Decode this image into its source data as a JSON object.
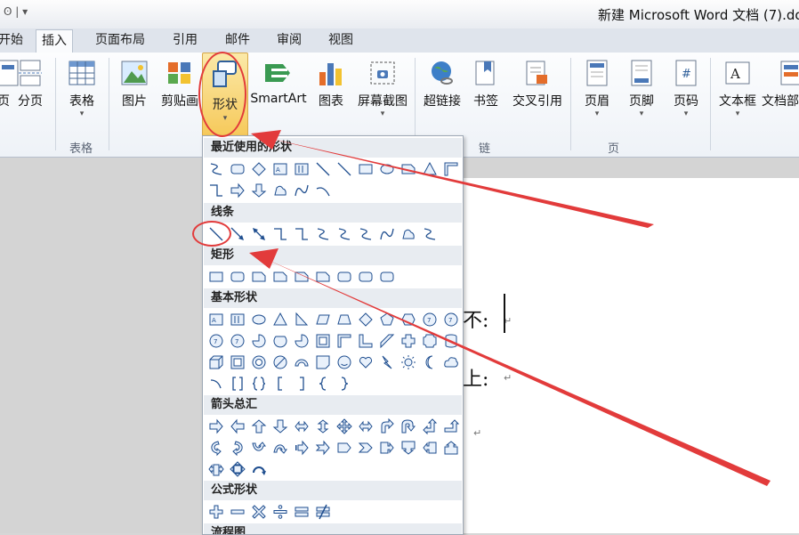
{
  "window": {
    "title": "新建 Microsoft Word 文档 (7).do",
    "qa_mark": "ʘ | ▾"
  },
  "tabs": [
    {
      "label": "开始"
    },
    {
      "label": "插入"
    },
    {
      "label": "页面布局"
    },
    {
      "label": "引用"
    },
    {
      "label": "邮件"
    },
    {
      "label": "审阅"
    },
    {
      "label": "视图"
    }
  ],
  "ribbon": {
    "buttons": [
      {
        "label": "页"
      },
      {
        "label": "分页"
      },
      {
        "label": "表格"
      },
      {
        "label": "图片"
      },
      {
        "label": "剪贴画"
      },
      {
        "label": "形状"
      },
      {
        "label": "SmartArt"
      },
      {
        "label": "图表"
      },
      {
        "label": "屏幕截图"
      },
      {
        "label": "超链接"
      },
      {
        "label": "书签"
      },
      {
        "label": "交叉引用"
      },
      {
        "label": "页眉"
      },
      {
        "label": "页脚"
      },
      {
        "label": "页码"
      },
      {
        "label": "文本框"
      },
      {
        "label": "文档部"
      }
    ],
    "groups": [
      {
        "label": "表格"
      },
      {
        "label": "链接"
      },
      {
        "label": "页眉和页脚"
      }
    ],
    "dropdown_glyph": "▾"
  },
  "gallery": {
    "sections": [
      {
        "label": "最近使用的形状"
      },
      {
        "label": "线条"
      },
      {
        "label": "矩形"
      },
      {
        "label": "基本形状"
      },
      {
        "label": "箭头总汇"
      },
      {
        "label": "公式形状"
      },
      {
        "label": "流程图"
      }
    ]
  },
  "document": {
    "line1": "不:",
    "line2": "上:",
    "return_mark": "↵"
  },
  "colors": {
    "annotation": "#e23b3b",
    "shape_highlight": "#f6c95a",
    "shape_icon": "#1f4e8f"
  }
}
